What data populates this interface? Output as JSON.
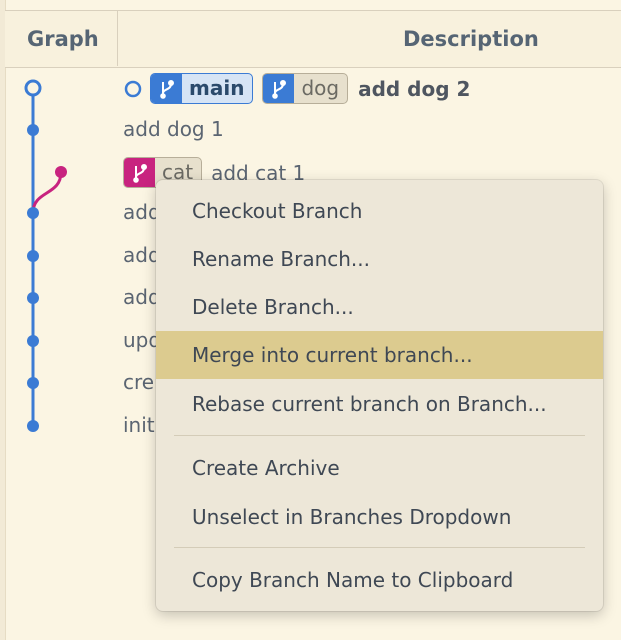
{
  "header": {
    "graph_label": "Graph",
    "description_label": "Description"
  },
  "commits": [
    {
      "message": "add dog 2",
      "branches": [
        "main",
        "dog"
      ],
      "current": true
    },
    {
      "message": "add dog 1"
    },
    {
      "message": "add cat 1",
      "branches": [
        "cat"
      ]
    },
    {
      "message": "add"
    },
    {
      "message": "add"
    },
    {
      "message": "add"
    },
    {
      "message": "upd"
    },
    {
      "message": "cre"
    },
    {
      "message": "init"
    }
  ],
  "context_menu": {
    "items": [
      "Checkout Branch",
      "Rename Branch...",
      "Delete Branch...",
      "Merge into current branch...",
      "Rebase current branch on Branch...",
      "Create Archive",
      "Unselect in Branches Dropdown",
      "Copy Branch Name to Clipboard"
    ],
    "highlighted_index": 3
  },
  "colors": {
    "main_branch": "#3b7bd4",
    "cat_branch": "#c8237f",
    "highlight": "#dccb8f",
    "background": "#fbf5e3"
  },
  "icons": {
    "branch": "branch-icon",
    "commit": "commit-node-icon"
  }
}
